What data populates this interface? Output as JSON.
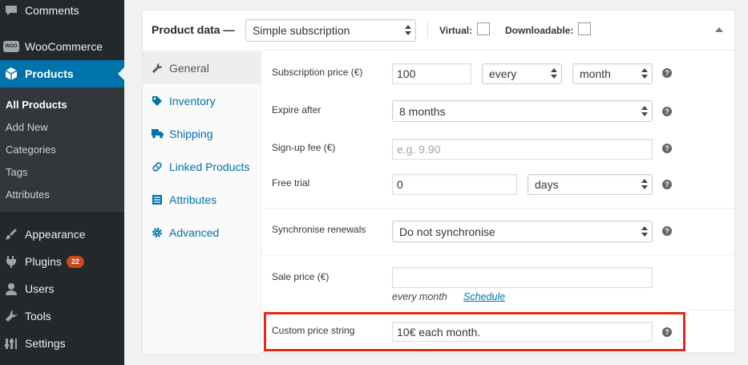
{
  "sidebar": {
    "menu": [
      {
        "label": "Comments",
        "icon": "comments-icon"
      },
      {
        "label": "WooCommerce",
        "icon": "woocommerce-icon",
        "logo_text": "WOO"
      },
      {
        "label": "Products",
        "icon": "products-icon"
      },
      {
        "label": "Appearance",
        "icon": "appearance-icon"
      },
      {
        "label": "Plugins",
        "icon": "plugins-icon",
        "badge": "22"
      },
      {
        "label": "Users",
        "icon": "users-icon"
      },
      {
        "label": "Tools",
        "icon": "tools-icon"
      },
      {
        "label": "Settings",
        "icon": "settings-icon"
      }
    ],
    "submenu": [
      "All Products",
      "Add New",
      "Categories",
      "Tags",
      "Attributes"
    ],
    "active_color": "#0073aa"
  },
  "panel": {
    "title": "Product data —",
    "product_type": "Simple subscription",
    "virtual_label": "Virtual:",
    "downloadable_label": "Downloadable:"
  },
  "tabs": [
    {
      "label": "General",
      "icon": "wrench-icon"
    },
    {
      "label": "Inventory",
      "icon": "tag-icon"
    },
    {
      "label": "Shipping",
      "icon": "truck-icon"
    },
    {
      "label": "Linked Products",
      "icon": "link-icon"
    },
    {
      "label": "Attributes",
      "icon": "list-icon"
    },
    {
      "label": "Advanced",
      "icon": "gear-icon"
    }
  ],
  "fields": {
    "subscription_price": {
      "label": "Subscription price (€)",
      "value": "100",
      "interval": "every",
      "period": "month"
    },
    "expire_after": {
      "label": "Expire after",
      "value": "8 months"
    },
    "signup_fee": {
      "label": "Sign-up fee (€)",
      "placeholder": "e.g. 9.90"
    },
    "free_trial": {
      "label": "Free trial",
      "value": "0",
      "period": "days"
    },
    "synchronise": {
      "label": "Synchronise renewals",
      "value": "Do not synchronise"
    },
    "sale_price": {
      "label": "Sale price (€)",
      "value": "",
      "note": "every month",
      "schedule_link": "Schedule"
    },
    "custom_price": {
      "label": "Custom price string",
      "value": "10€ each month."
    }
  },
  "help_glyph": "?",
  "highlight_color": "#e32a1a"
}
